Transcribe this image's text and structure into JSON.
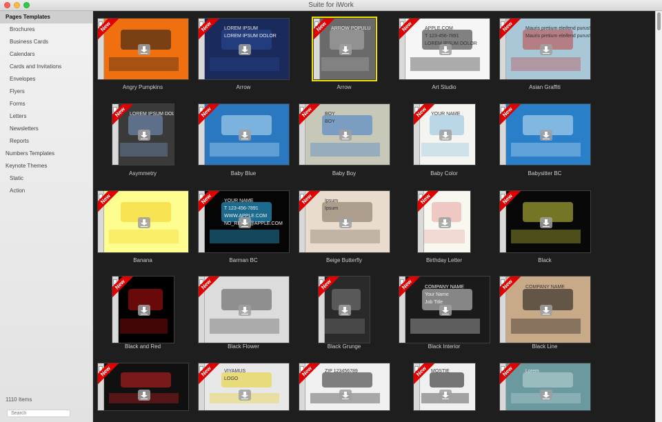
{
  "window": {
    "title": "Suite for iWork"
  },
  "sidebar": {
    "items": [
      {
        "label": "Pages Templates",
        "selected": true,
        "indent": 0
      },
      {
        "label": "Brochures",
        "indent": 1
      },
      {
        "label": "Business Cards",
        "indent": 1
      },
      {
        "label": "Calendars",
        "indent": 1
      },
      {
        "label": "Cards and Invitations",
        "indent": 1
      },
      {
        "label": "Envelopes",
        "indent": 1
      },
      {
        "label": "Flyers",
        "indent": 1
      },
      {
        "label": "Forms",
        "indent": 1
      },
      {
        "label": "Letters",
        "indent": 1
      },
      {
        "label": "Newsletters",
        "indent": 1
      },
      {
        "label": "Reports",
        "indent": 1
      },
      {
        "label": "Numbers Templates",
        "indent": 0
      },
      {
        "label": "Keynote Themes",
        "indent": 0
      },
      {
        "label": "Static",
        "indent": 1
      },
      {
        "label": "Action",
        "indent": 1
      }
    ],
    "count": "1110 Items",
    "search_placeholder": "Search"
  },
  "badge": "New",
  "templates": [
    {
      "name": "Angry Pumpkins",
      "bg": "#f07010",
      "accent": "#1a1a1a",
      "texts": [],
      "selected": false
    },
    {
      "name": "Arrow",
      "bg": "#1a2a5a",
      "accent": "#2c4a9a",
      "texts": [
        "LOREM IPSUM",
        "LOREM IPSUM DOLOR"
      ],
      "selected": false
    },
    {
      "name": "Arrow",
      "bg": "#6a6a6a",
      "accent": "#b0b0b0",
      "texts": [
        "ARROW POPULU"
      ],
      "selected": true
    },
    {
      "name": "Art Studio",
      "bg": "#f6f6f6",
      "accent": "#202020",
      "texts": [
        "APPLE.COM",
        "T 123-456-7891",
        "LOREM IPSUM DOLOR"
      ],
      "selected": false
    },
    {
      "name": "Asian Graffiti",
      "bg": "#a8c8d8",
      "accent": "#c04040",
      "texts": [
        "Mauris pretium eleifend purus!",
        "Mauris pretium eleifend purus!"
      ],
      "selected": false
    },
    {
      "name": "Asymmetry",
      "bg": "#3a3a3a",
      "accent": "#7a9aca",
      "texts": [
        "LOREM IPSUM DOLOR"
      ],
      "selected": false
    },
    {
      "name": "Baby Blue",
      "bg": "#2a78c0",
      "accent": "#bfe4f6",
      "texts": [],
      "selected": false
    },
    {
      "name": "Baby Boy",
      "bg": "#c8c8b8",
      "accent": "#3a7ac8",
      "texts": [
        "BOY",
        "BOY"
      ],
      "selected": false
    },
    {
      "name": "Baby Color",
      "bg": "#f4f4f0",
      "accent": "#8ac0e0",
      "texts": [
        "YOUR NAME"
      ],
      "selected": false
    },
    {
      "name": "Babysitter BC",
      "bg": "#2a80c8",
      "accent": "#c8e6f6",
      "texts": [],
      "selected": false
    },
    {
      "name": "Banana",
      "bg": "#fdfd90",
      "accent": "#f4d020",
      "texts": [],
      "selected": false
    },
    {
      "name": "Barman BC",
      "bg": "#050505",
      "accent": "#30c0ff",
      "texts": [
        "YOUR NAME",
        "T 123-456-7891",
        "WWW.APPLE.COM",
        "NO_REPLY@APPLE.COM"
      ],
      "selected": false
    },
    {
      "name": "Beige Butterfly",
      "bg": "#e9dccd",
      "accent": "#7a6a5a",
      "texts": [
        "Ipsum",
        "Ipsum"
      ],
      "selected": false
    },
    {
      "name": "Birthday Letter",
      "bg": "#f8f8f0",
      "accent": "#e8a0a0",
      "texts": [],
      "selected": false
    },
    {
      "name": "Black",
      "bg": "#080808",
      "accent": "#d0d040",
      "texts": [],
      "selected": false
    },
    {
      "name": "Black and Red",
      "bg": "#000000",
      "accent": "#c01010",
      "texts": [],
      "selected": false
    },
    {
      "name": "Black Flower",
      "bg": "#dcdcdc",
      "accent": "#505050",
      "texts": [],
      "selected": false
    },
    {
      "name": "Black Grunge",
      "bg": "#2a2a2a",
      "accent": "#808080",
      "texts": [],
      "selected": false
    },
    {
      "name": "Black Interior",
      "bg": "#1a1a1a",
      "accent": "#e0e0e0",
      "texts": [
        "COMPANY NAME",
        "Your Name",
        "Job Title"
      ],
      "selected": false
    },
    {
      "name": "Black Line",
      "bg": "#c8aa88",
      "accent": "#101010",
      "texts": [
        "COMPANY NAME"
      ],
      "selected": false
    },
    {
      "name": "",
      "bg": "#101010",
      "accent": "#d02020",
      "texts": [],
      "selected": false
    },
    {
      "name": "",
      "bg": "#e8e8e8",
      "accent": "#e8d020",
      "texts": [
        "VIYAMUS",
        "LOGO"
      ],
      "selected": false
    },
    {
      "name": "",
      "bg": "#f0f0f0",
      "accent": "#202020",
      "texts": [
        "ZIP 123456789"
      ],
      "selected": false
    },
    {
      "name": "",
      "bg": "#f0f0f0",
      "accent": "#101010",
      "texts": [
        "MOSTIE"
      ],
      "selected": false
    },
    {
      "name": "",
      "bg": "#6a9aa0",
      "accent": "#c0d8d8",
      "texts": [
        "Lorem"
      ],
      "selected": false
    }
  ]
}
